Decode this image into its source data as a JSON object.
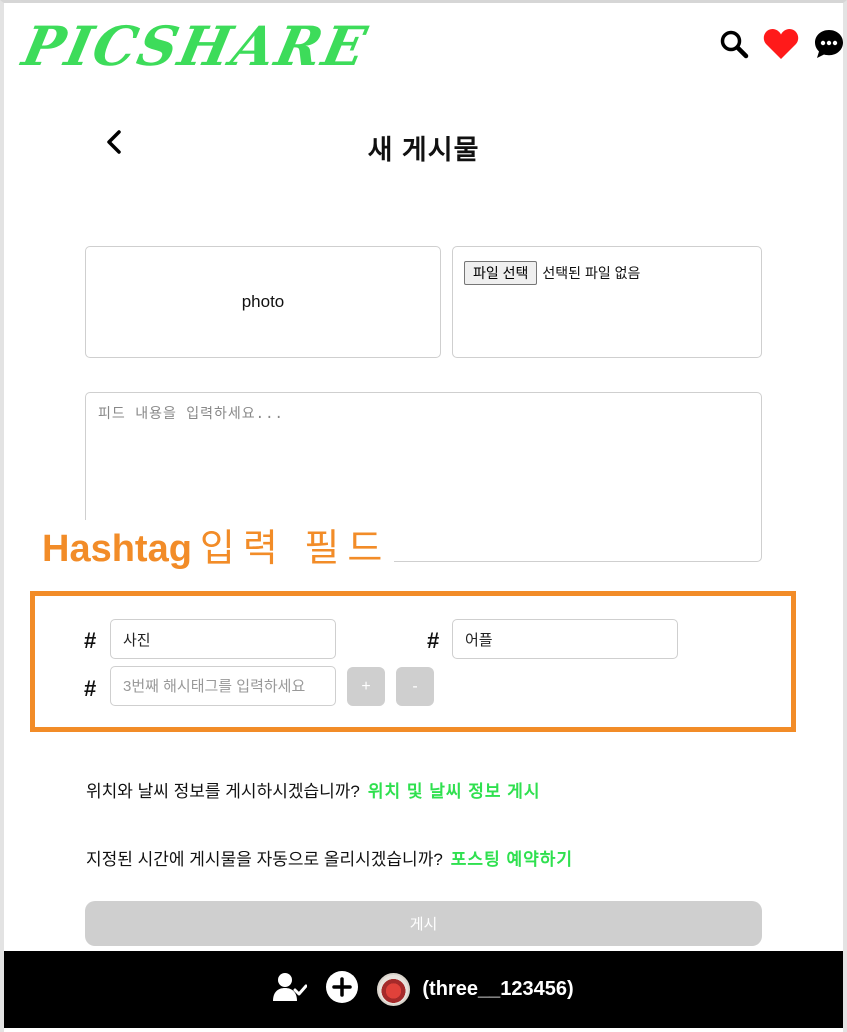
{
  "header": {
    "logo": "PICSHARE",
    "icons": [
      "search-icon",
      "heart-icon",
      "chat-icon"
    ],
    "accent_color": "#3ddc5a",
    "heart_color": "#ff1a1a"
  },
  "page": {
    "back_icon": "chevron-left-icon",
    "title": "새 게시물"
  },
  "upload": {
    "photo_label": "photo",
    "file_button_label": "파일 선택",
    "file_status": "선택된 파일 없음"
  },
  "feed": {
    "placeholder": "피드 내용을 입력하세요..."
  },
  "annotation": {
    "label_en": "Hashtag",
    "label_ko": "입력 필드",
    "color": "#f28c28"
  },
  "hashtags": {
    "symbol": "#",
    "tag1_value": "사진",
    "tag2_value": "어플",
    "tag3_placeholder": "3번째 해시태그를 입력하세요",
    "add_label": "+",
    "remove_label": "-"
  },
  "location": {
    "question": "위치와 날씨 정보를 게시하시겠습니까?",
    "link": "위치 및 날씨 정보 게시"
  },
  "schedule": {
    "question": "지정된 시간에 게시물을 자동으로 올리시겠습니까?",
    "link": "포스팅 예약하기"
  },
  "submit": {
    "label": "게시"
  },
  "footer": {
    "icons": [
      "user-check-icon",
      "add-circle-icon",
      "avatar"
    ],
    "username": "(three__123456)"
  }
}
